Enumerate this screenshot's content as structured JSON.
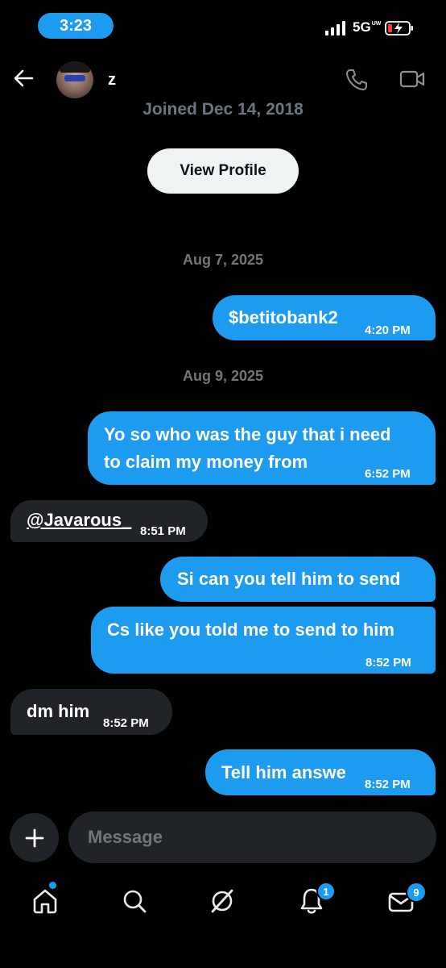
{
  "status_bar": {
    "time": "3:23",
    "network": "5G",
    "network_suffix": "UW"
  },
  "header": {
    "username": "z",
    "joined": "Joined Dec 14, 2018",
    "view_profile_label": "View Profile"
  },
  "dates": [
    "Aug 7, 2025",
    "Aug 9, 2025"
  ],
  "messages": [
    {
      "direction": "out",
      "lines": [
        "$betitobank2"
      ],
      "time": "4:20 PM"
    },
    {
      "direction": "out",
      "lines": [
        "Yo so who was the guy that i need",
        "to claim my money from"
      ],
      "time": "6:52 PM"
    },
    {
      "direction": "in",
      "lines": [
        "@Javarous_"
      ],
      "time": "8:51 PM"
    },
    {
      "direction": "out",
      "lines": [
        "Si can you tell him to send"
      ],
      "time": ""
    },
    {
      "direction": "out",
      "lines": [
        "Cs like you told me to send to him"
      ],
      "time": "8:52 PM"
    },
    {
      "direction": "in",
      "lines": [
        "dm him"
      ],
      "time": "8:52 PM"
    },
    {
      "direction": "out",
      "lines": [
        "Tell him answe"
      ],
      "time": "8:52 PM"
    }
  ],
  "composer": {
    "placeholder": "Message"
  },
  "tab_bar": {
    "items": [
      "home-icon",
      "search-icon",
      "grok-icon",
      "notifications-icon",
      "messages-icon"
    ],
    "notifications_badge": "1",
    "messages_badge": "9"
  },
  "colors": {
    "accent": "#1d9bf0",
    "incoming_bubble": "#202327",
    "background": "#000000"
  }
}
